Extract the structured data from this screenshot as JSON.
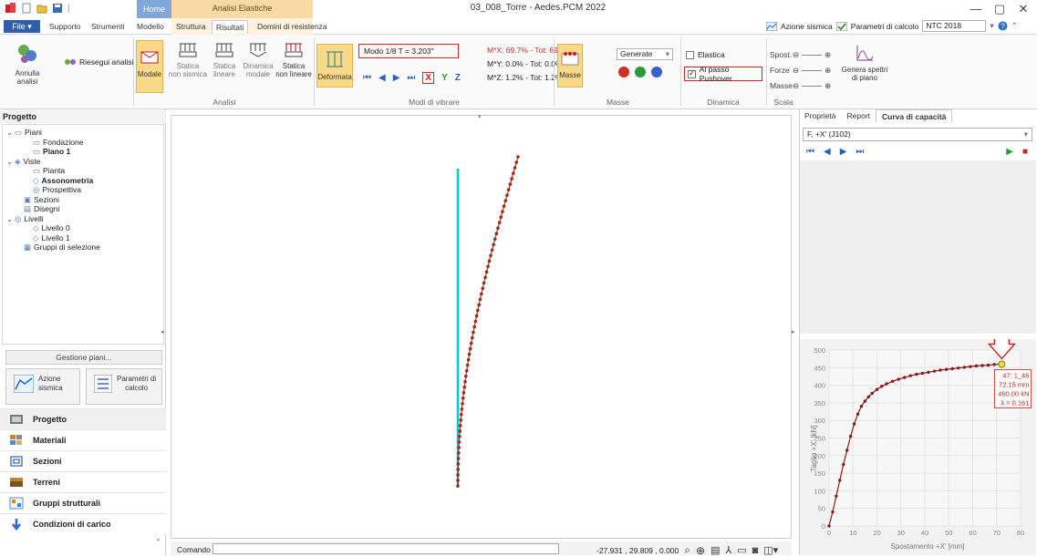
{
  "titlebar": {
    "document_title": "03_008_Torre - Aedes.PCM 2022",
    "contextual_tab_group": "Analisi Elastiche",
    "window_controls": [
      "—",
      "▢",
      "✕"
    ]
  },
  "ribbon_tabs": {
    "file": "File",
    "tabs": [
      "Supporto",
      "Strumenti",
      "Modello",
      "Struttura",
      "Risultati",
      "Domini di resistenza"
    ],
    "home": "Home",
    "active": "Risultati"
  },
  "top_right": {
    "azione_sismica": "Azione sismica",
    "parametri_calcolo": "Parametri di calcolo",
    "norm_value": "NTC 2018"
  },
  "ribbon": {
    "annulla_label": "Annulla analisi",
    "riesegui_label": "Riesegui analisi",
    "analisi_buttons": [
      {
        "label": "Modale",
        "sub": ""
      },
      {
        "label": "Statica",
        "sub": "non sismica"
      },
      {
        "label": "Statica",
        "sub": "lineare"
      },
      {
        "label": "Dinamica",
        "sub": "modale"
      },
      {
        "label": "Statica",
        "sub": "non lineare"
      }
    ],
    "analisi_group_label": "Analisi",
    "deformata_label": "Deformata",
    "modo_text": "Modo 1/8    T = 3.203\"",
    "axes": [
      "X",
      "Y",
      "Z"
    ],
    "mass_lines": [
      "M*X: 69.7% - Tot: 69.7%",
      "M*Y: 0.0% - Tot: 0.0%",
      "M*Z: 1.2% - Tot: 1.2%"
    ],
    "modi_group_label": "Modi di vibrare",
    "masse_label": "Masse",
    "generate_value": "Generate",
    "masse_group_label": "Masse",
    "elastica_label": "Elastica",
    "pushover_label": "Al passo Pushover",
    "dinamica_group_label": "Dinamica",
    "scala_rows": [
      "Spost.",
      "Forze",
      "Masse"
    ],
    "genera_label_1": "Genera spettri",
    "genera_label_2": "di piano",
    "scala_group_label": "Scala"
  },
  "left_panel": {
    "header": "Progetto",
    "tree": [
      {
        "label": "Piani",
        "indent": 0,
        "bold": false
      },
      {
        "label": "Fondazione",
        "indent": 2,
        "bold": false
      },
      {
        "label": "Piano 1",
        "indent": 2,
        "bold": true
      },
      {
        "label": "Viste",
        "indent": 0,
        "bold": false
      },
      {
        "label": "Pianta",
        "indent": 2,
        "bold": false
      },
      {
        "label": "Assonometria",
        "indent": 2,
        "bold": true
      },
      {
        "label": "Prospettiva",
        "indent": 2,
        "bold": false
      },
      {
        "label": "Sezioni",
        "indent": 1,
        "bold": false
      },
      {
        "label": "Disegni",
        "indent": 1,
        "bold": false
      },
      {
        "label": "Livelli",
        "indent": 0,
        "bold": false
      },
      {
        "label": "Livello 0",
        "indent": 2,
        "bold": false
      },
      {
        "label": "Livello 1",
        "indent": 2,
        "bold": false
      },
      {
        "label": "Gruppi di selezione",
        "indent": 1,
        "bold": false
      }
    ],
    "gestione_piani": "Gestione piani...",
    "azione_sismica_1": "Azione",
    "azione_sismica_2": "sismica",
    "parametri_1": "Parametri di",
    "parametri_2": "calcolo",
    "nav": [
      "Progetto",
      "Materiali",
      "Sezioni",
      "Terreni",
      "Gruppi strutturali",
      "Condizioni di carico"
    ]
  },
  "bottom": {
    "comando_label": "Comando",
    "coords": "-27.931 , 29.809 , 0.000"
  },
  "right_panel": {
    "tabs": [
      "Proprietà",
      "Report",
      "Curva di capacità"
    ],
    "active_tab": "Curva di capacità",
    "selected_curve": "F, +X' (J102)"
  },
  "chart_data": {
    "type": "line",
    "xlabel": "Spostamento +X' [mm]",
    "ylabel": "Taglio +X' [kN]",
    "xlim": [
      0,
      80
    ],
    "ylim": [
      0,
      500
    ],
    "xticks": [
      0,
      10,
      20,
      30,
      40,
      50,
      60,
      70,
      80
    ],
    "yticks": [
      0,
      50,
      100,
      150,
      200,
      250,
      300,
      350,
      400,
      450,
      500
    ],
    "series": [
      {
        "x": [
          0,
          1.5,
          3,
          4.5,
          6,
          7.5,
          9,
          10.5,
          12,
          13.5,
          15,
          16.5,
          18,
          20,
          22,
          24,
          26.5,
          29,
          31.5,
          34,
          36.5,
          39,
          41.5,
          44,
          46.5,
          49,
          51.5,
          54,
          56.5,
          59,
          61.5,
          64,
          66.5,
          69,
          72.15
        ],
        "y": [
          0,
          40,
          85,
          130,
          175,
          215,
          255,
          290,
          318,
          340,
          355,
          367,
          377,
          388,
          397,
          404,
          411,
          417,
          422,
          427,
          431,
          434,
          437,
          440,
          443,
          445,
          447,
          449,
          451,
          453,
          455,
          456,
          457,
          459,
          460
        ]
      }
    ],
    "highlight": {
      "x": 72.15,
      "y": 460,
      "label_lines": [
        "47: 1_46",
        "72.15 mm",
        "460.00 kN",
        "λ = 0.161"
      ]
    }
  },
  "colors": {
    "accent": "#2f5ea8",
    "curve": "#8b1a1a",
    "modal_line": "#00c8d8",
    "highlight_point": "#e8e040",
    "red_annotation": "#d22222"
  }
}
